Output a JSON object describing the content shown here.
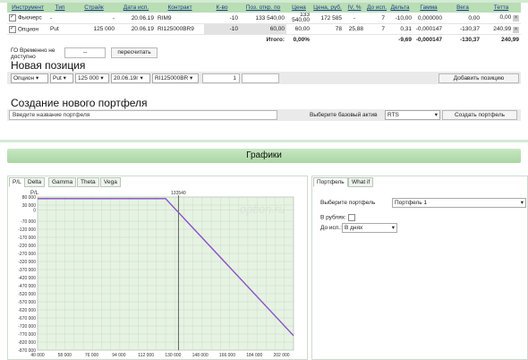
{
  "positions": {
    "headers": [
      "Инструмент",
      "Тип",
      "Страйк",
      "Дата исп.",
      "Контракт",
      "К-во",
      "Поз. откр. по",
      "Цена",
      "Цена, руб.",
      "IV, %",
      "До исп.",
      "Дельта",
      "Гамма",
      "Вега",
      "Тетта"
    ],
    "rows": [
      {
        "instrument": "Фьючерс",
        "type": "-",
        "strike": "-",
        "date": "20.06.19",
        "contract": "RIM9",
        "qty": "-10",
        "open": "133 540,00",
        "price": "133 540,00",
        "price_rub": "172 585",
        "iv": "-",
        "days": "7",
        "delta": "-10,00",
        "gamma": "0,000000",
        "vega": "0,00",
        "theta": "0,00"
      },
      {
        "instrument": "Опцион",
        "type": "Put",
        "strike": "125 000",
        "date": "20.06.19",
        "contract": "RI125000BR9",
        "qty": "-10",
        "open": "60,00",
        "price": "60,00",
        "price_rub": "78",
        "iv": "25,88",
        "days": "7",
        "delta": "0,31",
        "gamma": "-0,000147",
        "vega": "-130,37",
        "theta": "240,99"
      }
    ],
    "total": {
      "label": "Итого:",
      "open": "0,00%",
      "delta": "-9,69",
      "gamma": "-0,000147",
      "vega": "-130,37",
      "theta": "240,99"
    }
  },
  "go": {
    "label": "ГО Временно не доступно",
    "value": "--",
    "recalc": "пересчитать"
  },
  "new_position": {
    "title": "Новая позиция",
    "instrument": "Опцион",
    "type": "Put",
    "strike": "125 000",
    "date": "20.06.19г",
    "contract": "RI125000BR",
    "qty": "1",
    "add_button": "Добавить позицию"
  },
  "new_portfolio": {
    "title": "Создание нового портфеля",
    "name_placeholder": "Введите название портфеля",
    "base_label": "Выберите базовый актив",
    "base_value": "RTS",
    "create_button": "Создать портфель"
  },
  "graphs": {
    "title": "Графики",
    "tabs": [
      "P/L",
      "Delta",
      "Gamma",
      "Theta",
      "Vega"
    ],
    "right_tabs": [
      "Портфель",
      "What if"
    ],
    "portfolio_label": "Выберите портфель",
    "portfolio_value": "Портфель 1",
    "rub_label": "В рублях:",
    "exp_label": "До исп.:",
    "exp_value": "В днях"
  },
  "chart_data": {
    "type": "line",
    "title": "P/L",
    "watermark": "option.ru",
    "marker_label": "133540",
    "marker_x": 133540,
    "x": [
      40000,
      125000,
      130000,
      133540,
      210000
    ],
    "values": [
      70000,
      70000,
      20000,
      -15400,
      -780000
    ],
    "ylim": [
      -870000,
      80000
    ],
    "xlim": [
      40000,
      210000
    ],
    "yticks": [
      80000,
      30000,
      0,
      -70000,
      -120000,
      -170000,
      -220000,
      -270000,
      -320000,
      -370000,
      -420000,
      -470000,
      -520000,
      -570000,
      -620000,
      -670000,
      -720000,
      -770000,
      -820000,
      -870000
    ],
    "ytick_labels": [
      "80 000",
      "30 000",
      "0",
      "-70 000",
      "-120 000",
      "-170 000",
      "-220 000",
      "-270 000",
      "-320 000",
      "-370 000",
      "-420 000",
      "-470 000",
      "-520 000",
      "-570 000",
      "-620 000",
      "-670 000",
      "-720 000",
      "-770 000",
      "-820 000",
      "-870 000"
    ],
    "xticks": [
      40000,
      58000,
      76000,
      94000,
      112000,
      130000,
      148000,
      166000,
      184000,
      202000
    ],
    "xtick_labels": [
      "40 000",
      "58 000",
      "76 000",
      "94 000",
      "112 000",
      "130 000",
      "148 000",
      "166 000",
      "184 000",
      "202 000"
    ],
    "colors": {
      "line": "#8a4fc8",
      "grid": "#c8d6c8",
      "area": "#e6f3e2",
      "marker": "#444444"
    }
  }
}
